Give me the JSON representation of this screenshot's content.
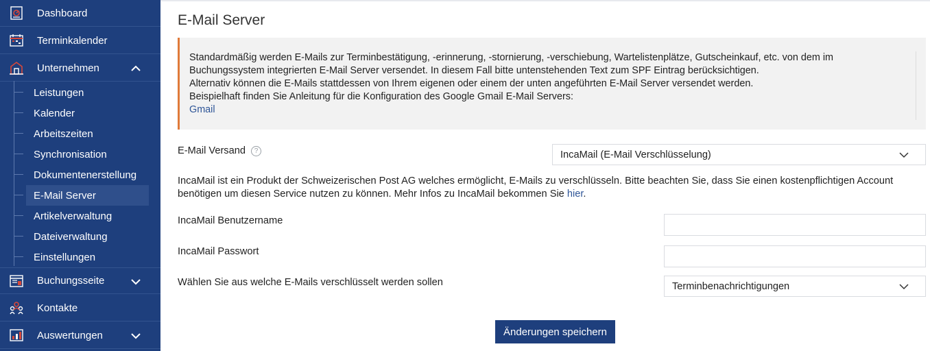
{
  "sidebar": {
    "main_items": [
      {
        "label": "Dashboard",
        "icon": "dashboard-icon"
      },
      {
        "label": "Terminkalender",
        "icon": "calendar-icon"
      },
      {
        "label": "Unternehmen",
        "icon": "building-icon",
        "expanded": true
      },
      {
        "label": "Buchungsseite",
        "icon": "booking-page-icon"
      },
      {
        "label": "Kontakte",
        "icon": "contacts-icon"
      },
      {
        "label": "Auswertungen",
        "icon": "reports-icon"
      }
    ],
    "sub_items": [
      {
        "label": "Leistungen"
      },
      {
        "label": "Kalender"
      },
      {
        "label": "Arbeitszeiten"
      },
      {
        "label": "Synchronisation"
      },
      {
        "label": "Dokumentenerstellung"
      },
      {
        "label": "E-Mail Server",
        "active": true
      },
      {
        "label": "Artikelverwaltung"
      },
      {
        "label": "Dateiverwaltung"
      },
      {
        "label": "Einstellungen"
      }
    ]
  },
  "main": {
    "title": "E-Mail Server",
    "info": {
      "line1": "Standardmäßig werden E-Mails zur Terminbestätigung, -erinnerung, -stornierung, -verschiebung, Wartelistenplätze, Gutscheinkauf, etc. von dem im",
      "line2": "Buchungssystem integrierten E-Mail Server versendet. In diesem Fall bitte untenstehenden Text zum SPF Eintrag berücksichtigen.",
      "line3": "Alternativ können die E-Mails stattdessen von Ihrem eigenen oder einem der unten angeführten E-Mail Server versendet werden.",
      "line4": "Beispielhaft finden Sie Anleitung für die Konfiguration des Google Gmail E-Mail Servers:",
      "link": "Gmail"
    },
    "versand": {
      "label": "E-Mail Versand",
      "help": "?",
      "selected": "IncaMail (E-Mail Verschlüsselung)"
    },
    "incamail_desc": {
      "text": "IncaMail ist ein Produkt der Schweizerischen Post AG welches ermöglicht, E-Mails zu verschlüsseln. Bitte beachten Sie, dass Sie einen kostenpflichtigen Account benötigen um diesen Service nutzen zu können. Mehr Infos zu IncaMail bekommen Sie ",
      "link": "hier",
      "suffix": "."
    },
    "username": {
      "label": "IncaMail Benutzername",
      "value": "",
      "placeholder": ""
    },
    "password": {
      "label": "IncaMail Passwort",
      "value": "",
      "placeholder": ""
    },
    "encrypt": {
      "label": "Wählen Sie aus welche E-Mails verschlüsselt werden sollen",
      "selected": "Terminbenachrichtigungen"
    },
    "save_label": "Änderungen speichern"
  },
  "colors": {
    "sidebar_bg": "#1e3f7d",
    "active_bg": "#2f4f8b",
    "accent_border": "#e07a3a",
    "icon_red": "#d8483a",
    "link": "#2e5597"
  }
}
